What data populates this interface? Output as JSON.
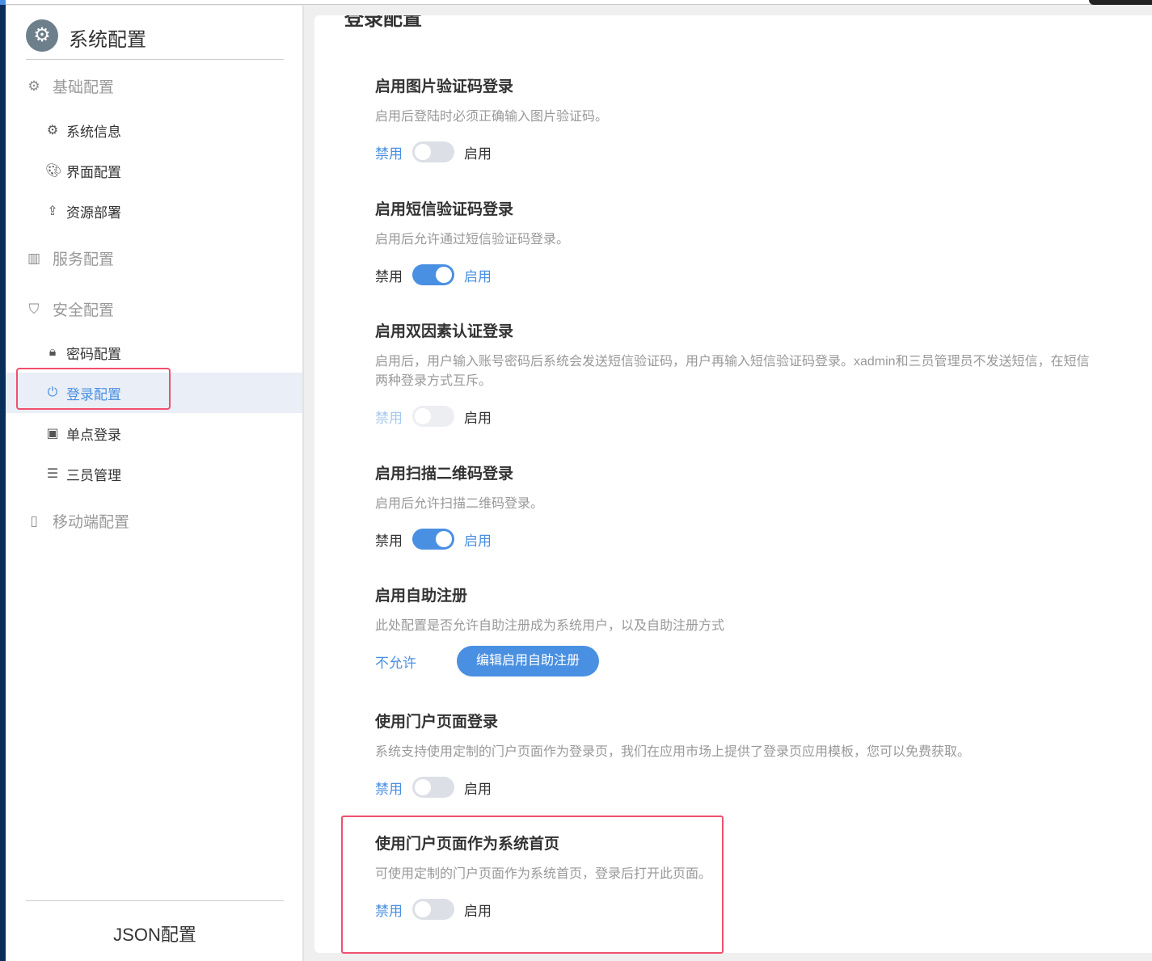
{
  "sidebar": {
    "title": "系统配置",
    "groups": [
      {
        "label": "基础配置",
        "icon": "gear-icon",
        "items": [
          {
            "label": "系统信息",
            "icon": "gear-icon"
          },
          {
            "label": "界面配置",
            "icon": "palette-icon"
          },
          {
            "label": "资源部署",
            "icon": "upload-icon"
          }
        ]
      },
      {
        "label": "服务配置",
        "icon": "server-icon",
        "items": []
      },
      {
        "label": "安全配置",
        "icon": "shield-icon",
        "items": [
          {
            "label": "密码配置",
            "icon": "lock-icon"
          },
          {
            "label": "登录配置",
            "icon": "power-icon",
            "active": true
          },
          {
            "label": "单点登录",
            "icon": "id-card-icon"
          },
          {
            "label": "三员管理",
            "icon": "list-icon"
          }
        ]
      },
      {
        "label": "移动端配置",
        "icon": "mobile-icon",
        "items": []
      }
    ],
    "json_label": "JSON配置"
  },
  "main": {
    "title": "登录配置",
    "sections": [
      {
        "title": "启用图片验证码登录",
        "desc": "启用后登陆时必须正确输入图片验证码。",
        "off": "禁用",
        "on": "启用",
        "enabled": false
      },
      {
        "title": "启用短信验证码登录",
        "desc": "启用后允许通过短信验证码登录。",
        "off": "禁用",
        "on": "启用",
        "enabled": true
      },
      {
        "title": "启用双因素认证登录",
        "desc": "启用后，用户输入账号密码后系统会发送短信验证码，用户再输入短信验证码登录。xadmin和三员管理员不发送短信，在短信",
        "desc2": "两种登录方式互斥。",
        "off": "禁用",
        "on": "启用",
        "enabled": false,
        "disabled": true
      },
      {
        "title": "启用扫描二维码登录",
        "desc": "启用后允许扫描二维码登录。",
        "off": "禁用",
        "on": "启用",
        "enabled": true
      },
      {
        "title": "启用自助注册",
        "desc": "此处配置是否允许自助注册成为系统用户，以及自助注册方式",
        "status": "不允许",
        "button": "编辑启用自助注册"
      },
      {
        "title": "使用门户页面登录",
        "desc": "系统支持使用定制的门户页面作为登录页，我们在应用市场上提供了登录页应用模板，您可以免费获取。",
        "off": "禁用",
        "on": "启用",
        "enabled": false
      },
      {
        "title": "使用门户页面作为系统首页",
        "desc": "可使用定制的门户页面作为系统首页，登录后打开此页面。",
        "off": "禁用",
        "on": "启用",
        "enabled": false
      }
    ]
  },
  "colors": {
    "accent": "#4a90e2",
    "highlight": "#f0506e",
    "nav": "#0b2d5a"
  }
}
